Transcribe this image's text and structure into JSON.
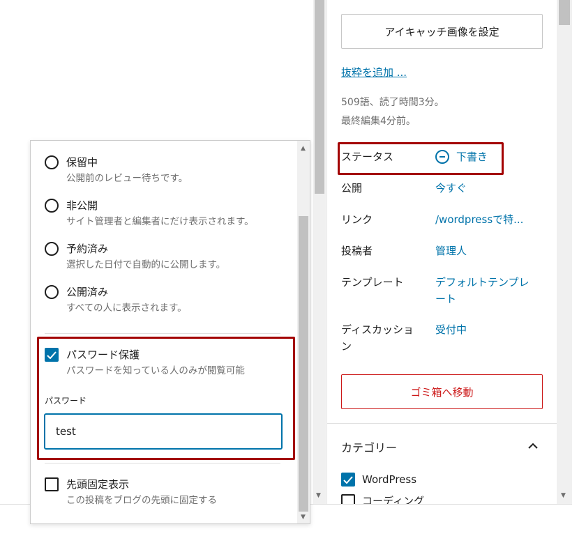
{
  "sidebar": {
    "featured_image_button": "アイキャッチ画像を設定",
    "excerpt_link": "抜粋を追加 ...",
    "word_count": "509語、読了時間3分。",
    "last_edited": "最終編集4分前。",
    "status": {
      "label": "ステータス",
      "value": "下書き"
    },
    "publish": {
      "label": "公開",
      "value": "今すぐ"
    },
    "link": {
      "label": "リンク",
      "value": "/wordpressで特..."
    },
    "author": {
      "label": "投稿者",
      "value": "管理人"
    },
    "template": {
      "label": "テンプレート",
      "value": "デフォルトテンプレート"
    },
    "discussion": {
      "label": "ディスカッション",
      "value": "受付中"
    },
    "trash_button": "ゴミ箱へ移動",
    "categories": {
      "title": "カテゴリー",
      "items": [
        {
          "label": "WordPress",
          "checked": true
        },
        {
          "label": "コーディング",
          "checked": false
        }
      ]
    }
  },
  "popover": {
    "options": [
      {
        "title": "保留中",
        "desc": "公開前のレビュー待ちです。"
      },
      {
        "title": "非公開",
        "desc": "サイト管理者と編集者にだけ表示されます。"
      },
      {
        "title": "予約済み",
        "desc": "選択した日付で自動的に公開します。"
      },
      {
        "title": "公開済み",
        "desc": "すべての人に表示されます。"
      }
    ],
    "password_protect": {
      "title": "パスワード保護",
      "desc": "パスワードを知っている人のみが閲覧可能",
      "checked": true
    },
    "password_label": "パスワード",
    "password_value": "test",
    "sticky": {
      "title": "先頭固定表示",
      "desc": "この投稿をブログの先頭に固定する",
      "checked": false
    }
  },
  "colors": {
    "accent": "#0073aa",
    "highlight": "#a30000",
    "danger": "#cc1818"
  }
}
